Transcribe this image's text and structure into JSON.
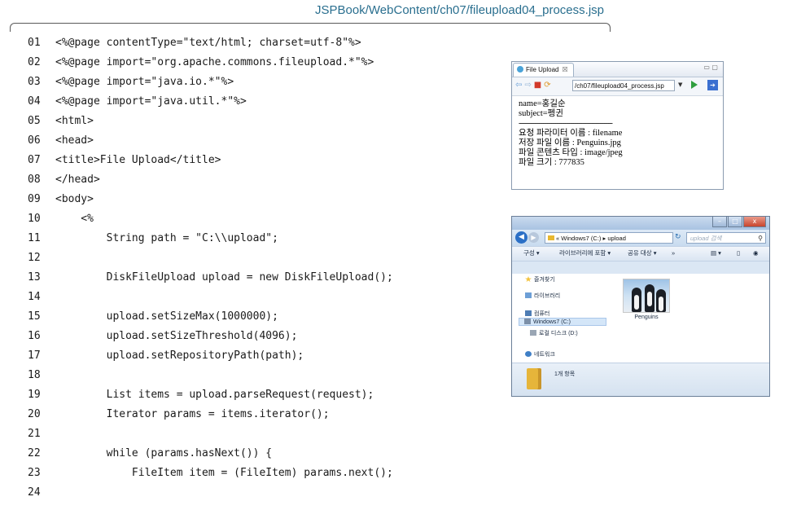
{
  "header": {
    "file_path": "JSPBook/WebContent/ch07/fileupload04_process.jsp"
  },
  "code_lines": [
    {
      "num": "01",
      "text": "<%@page contentType=\"text/html; charset=utf-8\"%>"
    },
    {
      "num": "02",
      "text": "<%@page import=\"org.apache.commons.fileupload.*\"%>"
    },
    {
      "num": "03",
      "text": "<%@page import=\"java.io.*\"%>"
    },
    {
      "num": "04",
      "text": "<%@page import=\"java.util.*\"%>"
    },
    {
      "num": "05",
      "text": "<html>"
    },
    {
      "num": "06",
      "text": "<head>"
    },
    {
      "num": "07",
      "text": "<title>File Upload</title>"
    },
    {
      "num": "08",
      "text": "</head>"
    },
    {
      "num": "09",
      "text": "<body>"
    },
    {
      "num": "10",
      "text": "    <%"
    },
    {
      "num": "11",
      "text": "        String path = \"C:\\\\upload\";"
    },
    {
      "num": "12",
      "text": ""
    },
    {
      "num": "13",
      "text": "        DiskFileUpload upload = new DiskFileUpload();"
    },
    {
      "num": "14",
      "text": ""
    },
    {
      "num": "15",
      "text": "        upload.setSizeMax(1000000);"
    },
    {
      "num": "16",
      "text": "        upload.setSizeThreshold(4096);"
    },
    {
      "num": "17",
      "text": "        upload.setRepositoryPath(path);"
    },
    {
      "num": "18",
      "text": ""
    },
    {
      "num": "19",
      "text": "        List items = upload.parseRequest(request);"
    },
    {
      "num": "20",
      "text": "        Iterator params = items.iterator();"
    },
    {
      "num": "21",
      "text": ""
    },
    {
      "num": "22",
      "text": "        while (params.hasNext()) {"
    },
    {
      "num": "23",
      "text": "            FileItem item = (FileItem) params.next();"
    },
    {
      "num": "24",
      "text": ""
    }
  ],
  "browser": {
    "tab_label": "File Upload",
    "tab_close": "☒",
    "window_controls": "▭ ▢",
    "url": "/ch07/fileupload04_process.jsp",
    "icons": [
      "globe-icon",
      "back-arrow-icon",
      "forward-arrow-icon",
      "stop-icon",
      "refresh-icon",
      "go-icon",
      "external-browser-icon"
    ],
    "lines": {
      "name": "name=홍길순",
      "subject": "subject=펭귄",
      "separator": "----------------------------------------------",
      "param_name": "요청 파라미터 이름 : filename",
      "saved_name": "저장 파일 이름 : Penguins.jpg",
      "content_type": "파일 콘텐츠 타입 : image/jpeg",
      "file_size": "파일 크기 : 777835"
    }
  },
  "explorer": {
    "controls": {
      "minimize": "–",
      "maximize": "□",
      "close": "x"
    },
    "breadcrumb": "« Windows7 (C:) ▸ upload",
    "search_placeholder": "upload 검색",
    "toolbar": {
      "organize": "구성 ▾",
      "include_library": "라이브러리에 포함 ▾",
      "share": "공유 대상 ▾",
      "more": "»"
    },
    "nav": {
      "favorites": "즐겨찾기",
      "libraries": "라이브러리",
      "computer": "컴퓨터",
      "drive_c": "Windows7 (C:)",
      "drive_d": "로컬 디스크 (D:)",
      "network": "네트워크"
    },
    "file_name": "Penguins",
    "item_count": "1개 항목"
  }
}
